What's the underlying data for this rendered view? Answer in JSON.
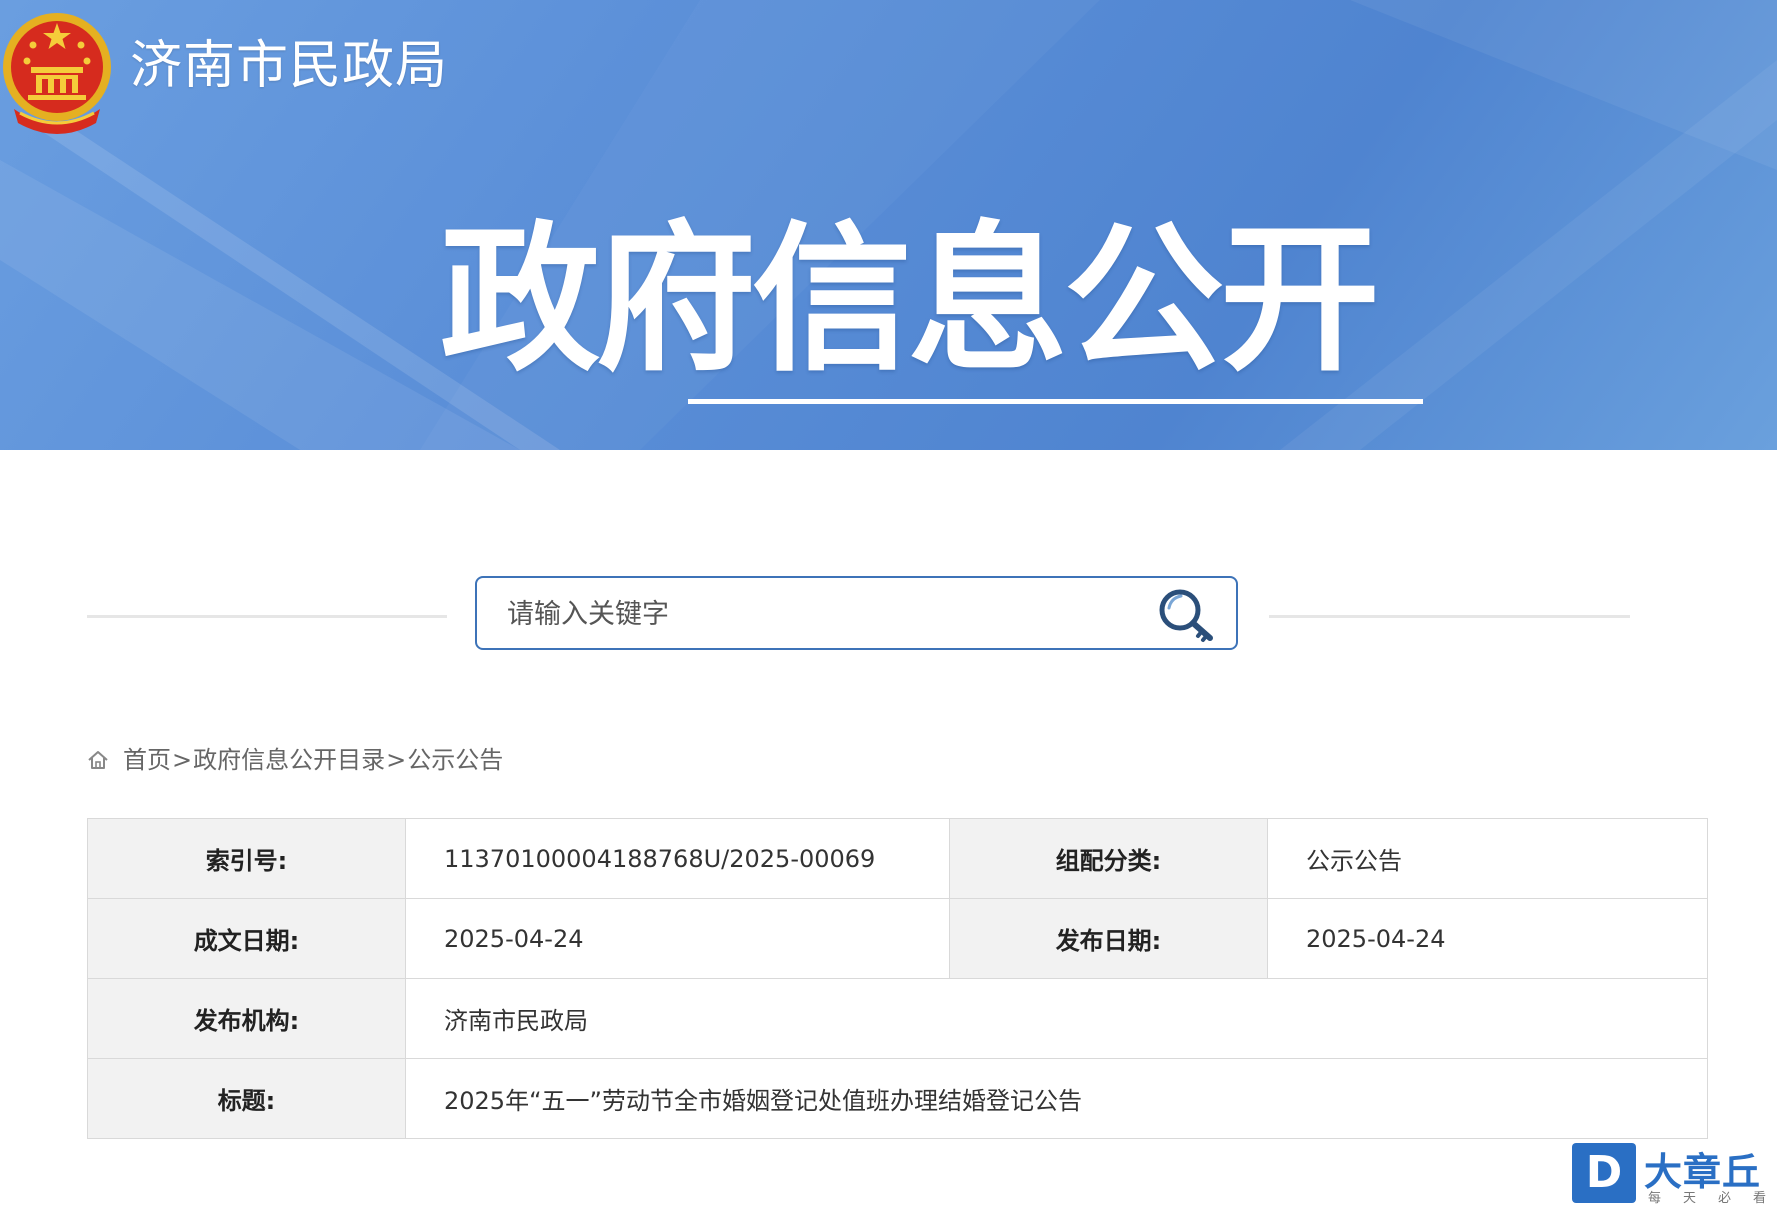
{
  "header": {
    "site_name": "济南市民政局",
    "banner_title": "政府信息公开"
  },
  "search": {
    "placeholder": "请输入关键字"
  },
  "breadcrumb": {
    "items": [
      "首页",
      "政府信息公开目录",
      "公示公告"
    ],
    "separator": ">"
  },
  "info": {
    "index_label": "索引号:",
    "index_value": "11370100004188768U/2025-00069",
    "category_label": "组配分类:",
    "category_value": "公示公告",
    "written_date_label": "成文日期:",
    "written_date_value": "2025-04-24",
    "publish_date_label": "发布日期:",
    "publish_date_value": "2025-04-24",
    "publisher_label": "发布机构:",
    "publisher_value": "济南市民政局",
    "title_label": "标题:",
    "title_value": "2025年“五一”劳动节全市婚姻登记处值班办理结婚登记公告"
  },
  "watermark": {
    "logo_letter": "D",
    "name": "大章丘",
    "slogan": "每天必看"
  },
  "colors": {
    "banner": "#5b8fd8",
    "search_border": "#3d73b8",
    "label_bg": "#f2f2f2",
    "watermark_blue": "#2a6fc4"
  },
  "icons": {
    "emblem": "national-emblem-icon",
    "search": "magnifier-key-icon",
    "home": "home-icon",
    "watermark_logo": "dazhangqiu-logo-icon"
  }
}
